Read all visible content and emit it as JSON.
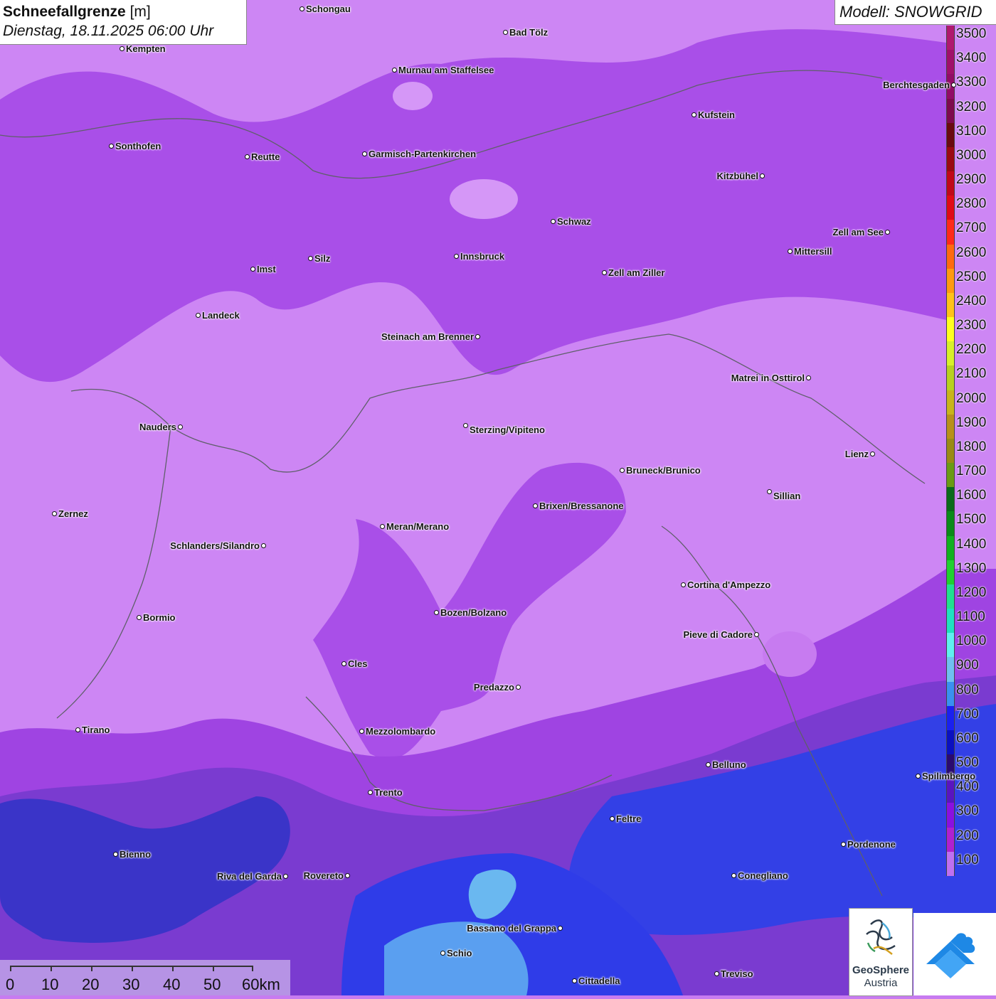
{
  "header": {
    "title": "Schneefallgrenze",
    "unit": "[m]",
    "datetime": "Dienstag, 18.11.2025 06:00 Uhr"
  },
  "model": {
    "label": "Modell: SNOWGRID"
  },
  "legend": {
    "levels": [
      {
        "label": "3500",
        "color": "#b0196e"
      },
      {
        "label": "3400",
        "color": "#a0106a"
      },
      {
        "label": "3300",
        "color": "#920c66"
      },
      {
        "label": "3200",
        "color": "#7e0a4e"
      },
      {
        "label": "3100",
        "color": "#6a0a10"
      },
      {
        "label": "3000",
        "color": "#9a0a12"
      },
      {
        "label": "2900",
        "color": "#c0081a"
      },
      {
        "label": "2800",
        "color": "#e00a18"
      },
      {
        "label": "2700",
        "color": "#ff2a1a"
      },
      {
        "label": "2600",
        "color": "#ff6a10"
      },
      {
        "label": "2500",
        "color": "#ff9a10"
      },
      {
        "label": "2400",
        "color": "#ffc21a"
      },
      {
        "label": "2300",
        "color": "#ffff20"
      },
      {
        "label": "2200",
        "color": "#d8f02a"
      },
      {
        "label": "2100",
        "color": "#b8d020"
      },
      {
        "label": "2000",
        "color": "#c8b41a"
      },
      {
        "label": "1900",
        "color": "#b8901a"
      },
      {
        "label": "1800",
        "color": "#9a8a14"
      },
      {
        "label": "1700",
        "color": "#6a9a14"
      },
      {
        "label": "1600",
        "color": "#0a6a1a"
      },
      {
        "label": "1500",
        "color": "#0a8a1a"
      },
      {
        "label": "1400",
        "color": "#10b020"
      },
      {
        "label": "1300",
        "color": "#20d030"
      },
      {
        "label": "1200",
        "color": "#20e090"
      },
      {
        "label": "1100",
        "color": "#20e0c0"
      },
      {
        "label": "1000",
        "color": "#60f0f0"
      },
      {
        "label": "900",
        "color": "#70c0f0"
      },
      {
        "label": "800",
        "color": "#3a90f0"
      },
      {
        "label": "700",
        "color": "#1a20f0"
      },
      {
        "label": "600",
        "color": "#0a10c0"
      },
      {
        "label": "500",
        "color": "#2a0a70"
      },
      {
        "label": "400",
        "color": "#5a14c0"
      },
      {
        "label": "300",
        "color": "#8a10e0"
      },
      {
        "label": "200",
        "color": "#b020d0"
      },
      {
        "label": "100",
        "color": "#c070f0"
      }
    ]
  },
  "cities": [
    {
      "name": "Schongau"
    },
    {
      "name": "Bad Tölz"
    },
    {
      "name": "Kempten"
    },
    {
      "name": "Murnau am Staffelsee"
    },
    {
      "name": "Berchtesgaden"
    },
    {
      "name": "Kufstein"
    },
    {
      "name": "Sonthofen"
    },
    {
      "name": "Reutte"
    },
    {
      "name": "Garmisch-Partenkirchen"
    },
    {
      "name": "Kitzbühel"
    },
    {
      "name": "Schwaz"
    },
    {
      "name": "Zell am See"
    },
    {
      "name": "Innsbruck"
    },
    {
      "name": "Mittersill"
    },
    {
      "name": "Imst"
    },
    {
      "name": "Silz"
    },
    {
      "name": "Zell am Ziller"
    },
    {
      "name": "Landeck"
    },
    {
      "name": "Steinach am Brenner"
    },
    {
      "name": "Matrei in Osttirol"
    },
    {
      "name": "Nauders"
    },
    {
      "name": "Sterzing/Vipiteno"
    },
    {
      "name": "Lienz"
    },
    {
      "name": "Bruneck/Brunico"
    },
    {
      "name": "Sillian"
    },
    {
      "name": "Brixen/Bressanone"
    },
    {
      "name": "Zernez"
    },
    {
      "name": "Meran/Merano"
    },
    {
      "name": "Schlanders/Silandro"
    },
    {
      "name": "Cortina d'Ampezzo"
    },
    {
      "name": "Bozen/Bolzano"
    },
    {
      "name": "Bormio"
    },
    {
      "name": "Pieve di Cadore"
    },
    {
      "name": "Cles"
    },
    {
      "name": "Predazzo"
    },
    {
      "name": "Tirano"
    },
    {
      "name": "Mezzolombardo"
    },
    {
      "name": "Belluno"
    },
    {
      "name": "Spilimbergo"
    },
    {
      "name": "Trento"
    },
    {
      "name": "Feltre"
    },
    {
      "name": "Pordenone"
    },
    {
      "name": "Bienno"
    },
    {
      "name": "Riva del Garda"
    },
    {
      "name": "Rovereto"
    },
    {
      "name": "Conegliano"
    },
    {
      "name": "Bassano del Grappa"
    },
    {
      "name": "Schio"
    },
    {
      "name": "Treviso"
    },
    {
      "name": "Cittadella"
    }
  ],
  "scale": {
    "labels": [
      "0",
      "10",
      "20",
      "30",
      "40",
      "50",
      "60km"
    ]
  },
  "logo": {
    "name": "GeoSphere",
    "sub": "Austria"
  }
}
